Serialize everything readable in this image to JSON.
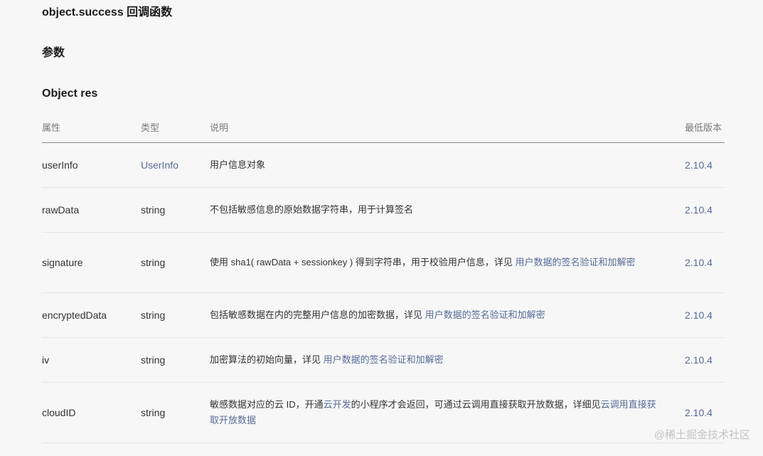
{
  "header": {
    "title": "object.success 回调函数",
    "params_heading": "参数",
    "object_heading": "Object res"
  },
  "table": {
    "columns": [
      "属性",
      "类型",
      "说明",
      "最低版本"
    ],
    "rows": [
      {
        "attr": "userInfo",
        "type": "UserInfo",
        "desc": "用户信息对象",
        "link": "",
        "desc_suffix": "",
        "version": "2.10.4"
      },
      {
        "attr": "rawData",
        "type": "string",
        "desc": "不包括敏感信息的原始数据字符串，用于计算签名",
        "link": "",
        "desc_suffix": "",
        "version": "2.10.4"
      },
      {
        "attr": "signature",
        "type": "string",
        "desc": "使用 sha1( rawData + sessionkey ) 得到字符串，用于校验用户信息，详见 ",
        "link": "用户数据的签名验证和加解密",
        "desc_suffix": "",
        "version": "2.10.4"
      },
      {
        "attr": "encryptedData",
        "type": "string",
        "desc": "包括敏感数据在内的完整用户信息的加密数据，详见 ",
        "link": "用户数据的签名验证和加解密",
        "desc_suffix": "",
        "version": "2.10.4"
      },
      {
        "attr": "iv",
        "type": "string",
        "desc": "加密算法的初始向量，详见 ",
        "link": "用户数据的签名验证和加解密",
        "desc_suffix": "",
        "version": "2.10.4"
      },
      {
        "attr": "cloudID",
        "type": "string",
        "desc": "敏感数据对应的云 ID，开通",
        "link": "云开发",
        "desc_suffix": "的小程序才会返回，可通过云调用直接获取开放数据，详细见",
        "link2": "云调用直接获取开放数据",
        "version": "2.10.4"
      }
    ]
  },
  "watermark": "@稀土掘金技术社区",
  "colors": {
    "link": "#576b95",
    "background": "#f7f7f8"
  }
}
